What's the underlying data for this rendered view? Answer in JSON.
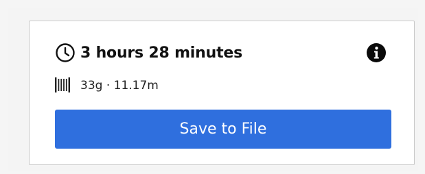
{
  "print_info": {
    "time": "3 hours 28 minutes",
    "material": "33g · 11.17m"
  },
  "actions": {
    "save_label": "Save to File"
  },
  "icons": {
    "time": "clock-icon",
    "info": "info-icon",
    "material": "filament-spool-icon"
  },
  "colors": {
    "primary": "#2f6fde",
    "text": "#111111"
  }
}
